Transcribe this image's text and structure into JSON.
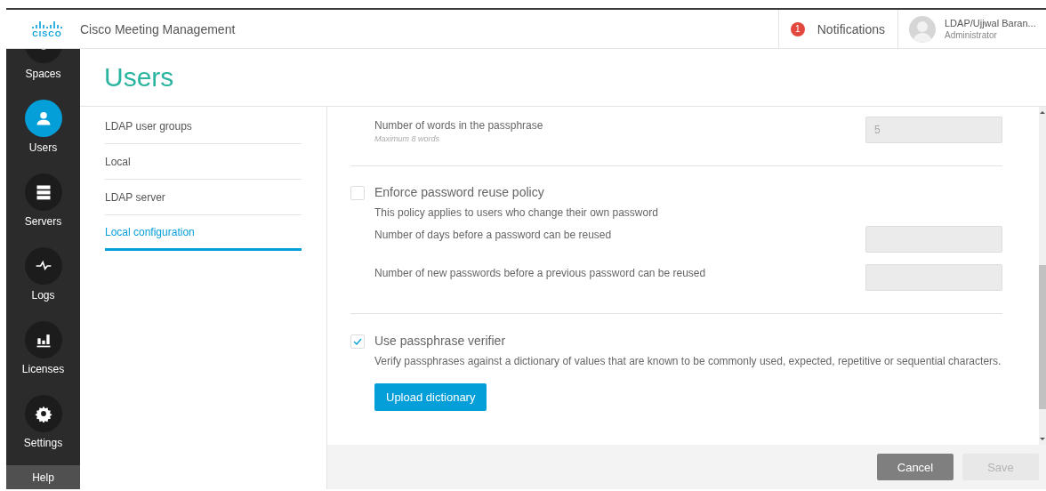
{
  "header": {
    "logo": "CISCO",
    "title": "Cisco Meeting Management",
    "notifications": {
      "count": "1",
      "label": "Notifications"
    },
    "user": {
      "name": "LDAP/Ujjwal Baran...",
      "role": "Administrator"
    }
  },
  "sidebar": {
    "items": [
      {
        "label": "Spaces",
        "selected": false
      },
      {
        "label": "Users",
        "selected": true
      },
      {
        "label": "Servers",
        "selected": false
      },
      {
        "label": "Logs",
        "selected": false
      },
      {
        "label": "Licenses",
        "selected": false
      },
      {
        "label": "Settings",
        "selected": false
      }
    ],
    "help": "Help"
  },
  "page_title": "Users",
  "subnav": [
    {
      "label": "LDAP user groups",
      "selected": false
    },
    {
      "label": "Local",
      "selected": false
    },
    {
      "label": "LDAP server",
      "selected": false
    },
    {
      "label": "Local configuration",
      "selected": true
    }
  ],
  "form": {
    "sections": [
      {
        "kind": "field",
        "label": "Number of words in the passphrase",
        "hint": "Maximum 8 words",
        "value": "5",
        "disabled": true
      },
      {
        "kind": "option",
        "label": "Enforce password reuse policy",
        "checked": false,
        "description": "This policy applies to users who change their own password",
        "fields": [
          {
            "label": "Number of days before a password can be reused",
            "disabled": true
          },
          {
            "label": "Number of new passwords before a previous password can be reused",
            "disabled": true
          }
        ]
      },
      {
        "kind": "option",
        "label": "Use passphrase verifier",
        "checked": true,
        "description": "Verify passphrases against a dictionary of values that are known to be commonly used, expected, repetitive or sequential characters.",
        "button": "Upload dictionary"
      }
    ]
  },
  "footer": {
    "buttons": [
      {
        "label": "Cancel",
        "disabled": false
      },
      {
        "label": "Save",
        "disabled": true
      }
    ]
  }
}
